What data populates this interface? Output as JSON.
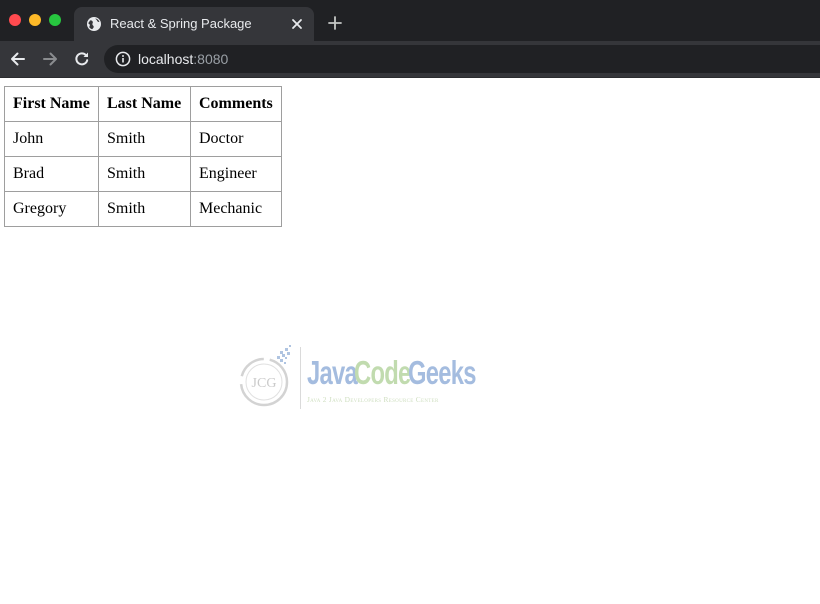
{
  "browser": {
    "tab": {
      "title": "React & Spring Package",
      "icon": "globe-icon"
    },
    "new_tab_icon": "plus-icon",
    "nav": {
      "back_icon": "arrow-left-icon",
      "forward_icon": "arrow-right-icon",
      "reload_icon": "reload-icon"
    },
    "address": {
      "icon": "info-icon",
      "host": "localhost",
      "port": ":8080"
    },
    "window_controls": [
      "close",
      "minimize",
      "maximize"
    ],
    "colors": {
      "close": "#ff4a4f",
      "minimize": "#fdb928",
      "maximize": "#27c63f"
    }
  },
  "table": {
    "headers": [
      "First Name",
      "Last Name",
      "Comments"
    ],
    "rows": [
      [
        "John",
        "Smith",
        "Doctor"
      ],
      [
        "Brad",
        "Smith",
        "Engineer"
      ],
      [
        "Gregory",
        "Smith",
        "Mechanic"
      ]
    ]
  },
  "watermark": {
    "monogram": "JCG",
    "words": [
      "Java",
      "Code",
      "Geeks"
    ],
    "tagline": "Java 2 Java Developers Resource Center",
    "colors": {
      "java": "#5b86c6",
      "code": "#8fbf6e",
      "geeks": "#5b86c6"
    }
  }
}
